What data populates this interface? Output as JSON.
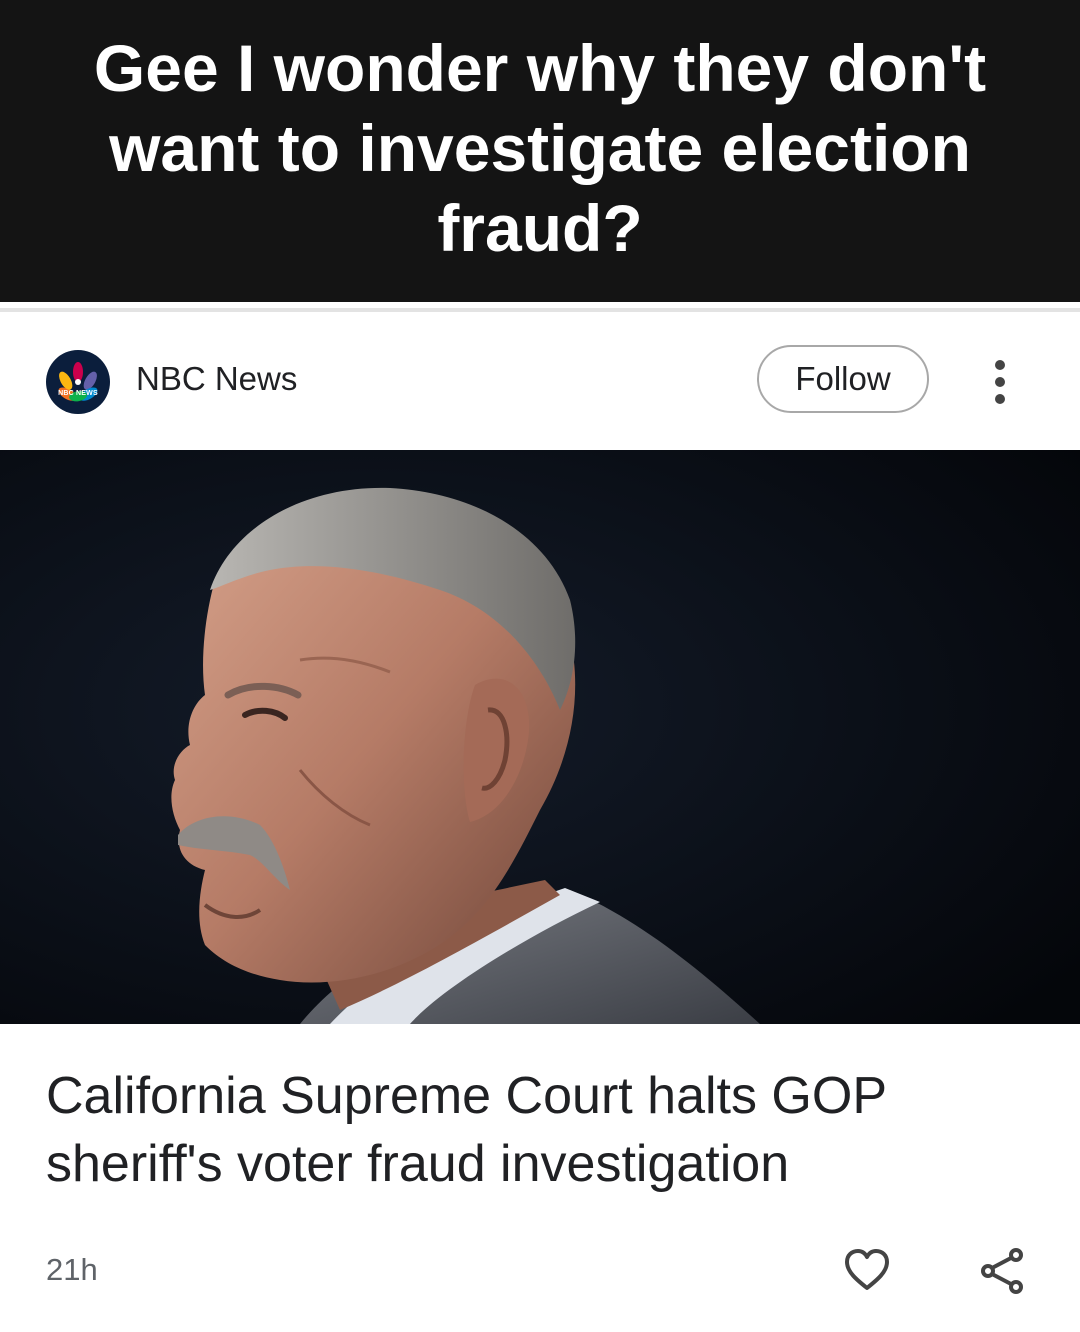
{
  "caption": {
    "text": "Gee I wonder why they don't want to investigate election fraud?"
  },
  "source": {
    "name": "NBC News",
    "logo_text": "NBC NEWS",
    "follow_label": "Follow"
  },
  "article": {
    "image_icon": "person-photo",
    "headline": "California Supreme Court halts GOP sheriff's voter fraud investigation",
    "age": "21h"
  },
  "actions": {
    "like_icon": "heart-icon",
    "share_icon": "share-icon"
  },
  "colors": {
    "caption_bg": "#141414",
    "caption_text": "#ffffff",
    "logo_bg": "#0b1e3c",
    "text_primary": "#202124",
    "text_secondary": "#5f6368"
  }
}
